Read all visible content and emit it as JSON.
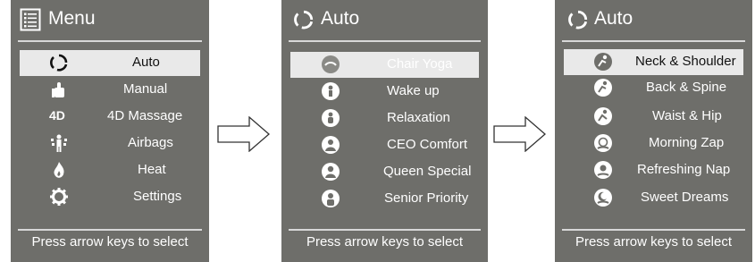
{
  "panel1": {
    "title": "Menu",
    "items": [
      {
        "label": "Auto",
        "icon": "cycle-icon"
      },
      {
        "label": "Manual",
        "icon": "hand-icon"
      },
      {
        "label": "4D Massage",
        "icon": "4d-icon",
        "icon_text": "4D"
      },
      {
        "label": "Airbags",
        "icon": "airbag-icon"
      },
      {
        "label": "Heat",
        "icon": "flame-icon"
      },
      {
        "label": "Settings",
        "icon": "gear-icon"
      }
    ],
    "footer": "Press arrow keys to select"
  },
  "panel2": {
    "title": "Auto",
    "items": [
      {
        "label": "Chair Yoga",
        "icon": "yoga-icon"
      },
      {
        "label": "Wake up",
        "icon": "wake-icon"
      },
      {
        "label": "Relaxation",
        "icon": "relax-icon"
      },
      {
        "label": "CEO Comfort",
        "icon": "ceo-icon"
      },
      {
        "label": "Queen Special",
        "icon": "queen-icon"
      },
      {
        "label": "Senior Priority",
        "icon": "senior-icon"
      }
    ],
    "footer": "Press arrow keys to select"
  },
  "panel3": {
    "title": "Auto",
    "items": [
      {
        "label": "Neck & Shoulder",
        "icon": "neck-icon"
      },
      {
        "label": "Back & Spine",
        "icon": "back-icon"
      },
      {
        "label": "Waist & Hip",
        "icon": "waist-icon"
      },
      {
        "label": "Morning Zap",
        "icon": "alarm-icon"
      },
      {
        "label": "Refreshing Nap",
        "icon": "nap-icon"
      },
      {
        "label": "Sweet Dreams",
        "icon": "dream-icon"
      }
    ],
    "footer": "Press arrow keys to select"
  },
  "colors": {
    "panel_bg": "#6e6e6a",
    "selected_bg": "#e9e9e9",
    "text": "#ffffff"
  }
}
